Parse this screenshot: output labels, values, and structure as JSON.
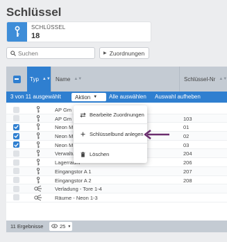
{
  "page": {
    "title": "Schlüssel"
  },
  "stat": {
    "label": "SCHLÜSSEL",
    "value": "18",
    "icon": "key-icon"
  },
  "search": {
    "placeholder": "Suchen",
    "value": ""
  },
  "toolbar": {
    "assign_label": "Zuordnungen"
  },
  "table": {
    "columns": {
      "typ": "Typ",
      "name": "Name",
      "nr": "Schlüssel-Nr"
    },
    "selection": {
      "count_text": "3 von 11 ausgewählt",
      "action_label": "Aktion",
      "select_all_label": "Alle auswählen",
      "deselect_label": "Auswahl aufheben"
    },
    "rows": [
      {
        "name": "AP Gm",
        "nr": "",
        "checked": false,
        "icon": "key-icon"
      },
      {
        "name": "AP Gm",
        "nr": "103",
        "checked": false,
        "icon": "key-icon"
      },
      {
        "name": "Neon M",
        "nr": "01",
        "checked": true,
        "icon": "key-icon"
      },
      {
        "name": "Neon M",
        "nr": "02",
        "checked": true,
        "icon": "key-icon"
      },
      {
        "name": "Neon M",
        "nr": "03",
        "checked": true,
        "icon": "key-icon"
      },
      {
        "name": "Verwaltung Schlüssel vorne",
        "nr": "204",
        "checked": false,
        "icon": "key-icon"
      },
      {
        "name": "Lagerraum",
        "nr": "206",
        "checked": false,
        "icon": "key-icon"
      },
      {
        "name": "Eingangstor A 1",
        "nr": "207",
        "checked": false,
        "icon": "key-icon"
      },
      {
        "name": "Eingangstor A 2",
        "nr": "208",
        "checked": false,
        "icon": "key-icon"
      },
      {
        "name": "Verladung - Tore 1-4",
        "nr": "",
        "checked": false,
        "icon": "keyring-icon"
      },
      {
        "name": "Räume - Neon 1-3",
        "nr": "",
        "checked": false,
        "icon": "keyring-icon"
      }
    ],
    "footer": {
      "count_text": "11 Ergebnisse",
      "per_page": "25"
    }
  },
  "action_menu": {
    "items": [
      {
        "label": "Bearbeite Zuordnungen",
        "icon": "swap-icon"
      },
      {
        "label": "Schlüsselbund anlegen",
        "icon": "plus-icon"
      },
      {
        "label": "Löschen",
        "icon": "trash-icon"
      }
    ]
  },
  "colors": {
    "accent": "#2f7fd0",
    "annotation_arrow": "#6b2d6e",
    "header_bg": "#c4cbd3"
  }
}
